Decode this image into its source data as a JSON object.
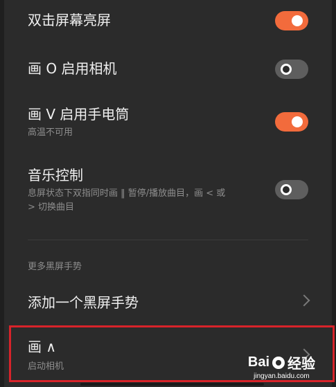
{
  "settings": {
    "double_tap": {
      "title": "双击屏幕亮屏",
      "enabled": true
    },
    "draw_o": {
      "title": "画 O 启用相机",
      "enabled": false
    },
    "draw_v": {
      "title": "画 V 启用手电筒",
      "subtitle": "高温不可用",
      "enabled": true
    },
    "music": {
      "title": "音乐控制",
      "subtitle_line1": "息屏状态下双指同时画 ‖ 暂停/播放曲目，画 < 或",
      "subtitle_line2": "> 切换曲目",
      "enabled": false
    }
  },
  "more_section": {
    "header": "更多黑屏手势",
    "add_gesture": "添加一个黑屏手势",
    "gesture_item": {
      "title": "画 ∧",
      "subtitle": "启动相机"
    }
  },
  "watermark": {
    "logo_left": "Bai",
    "logo_right": "经验",
    "url": "jingyan.baidu.com"
  },
  "colors": {
    "toggle_on": "#f26b3c",
    "toggle_off": "#5e5e5e",
    "highlight": "#d8232a"
  }
}
